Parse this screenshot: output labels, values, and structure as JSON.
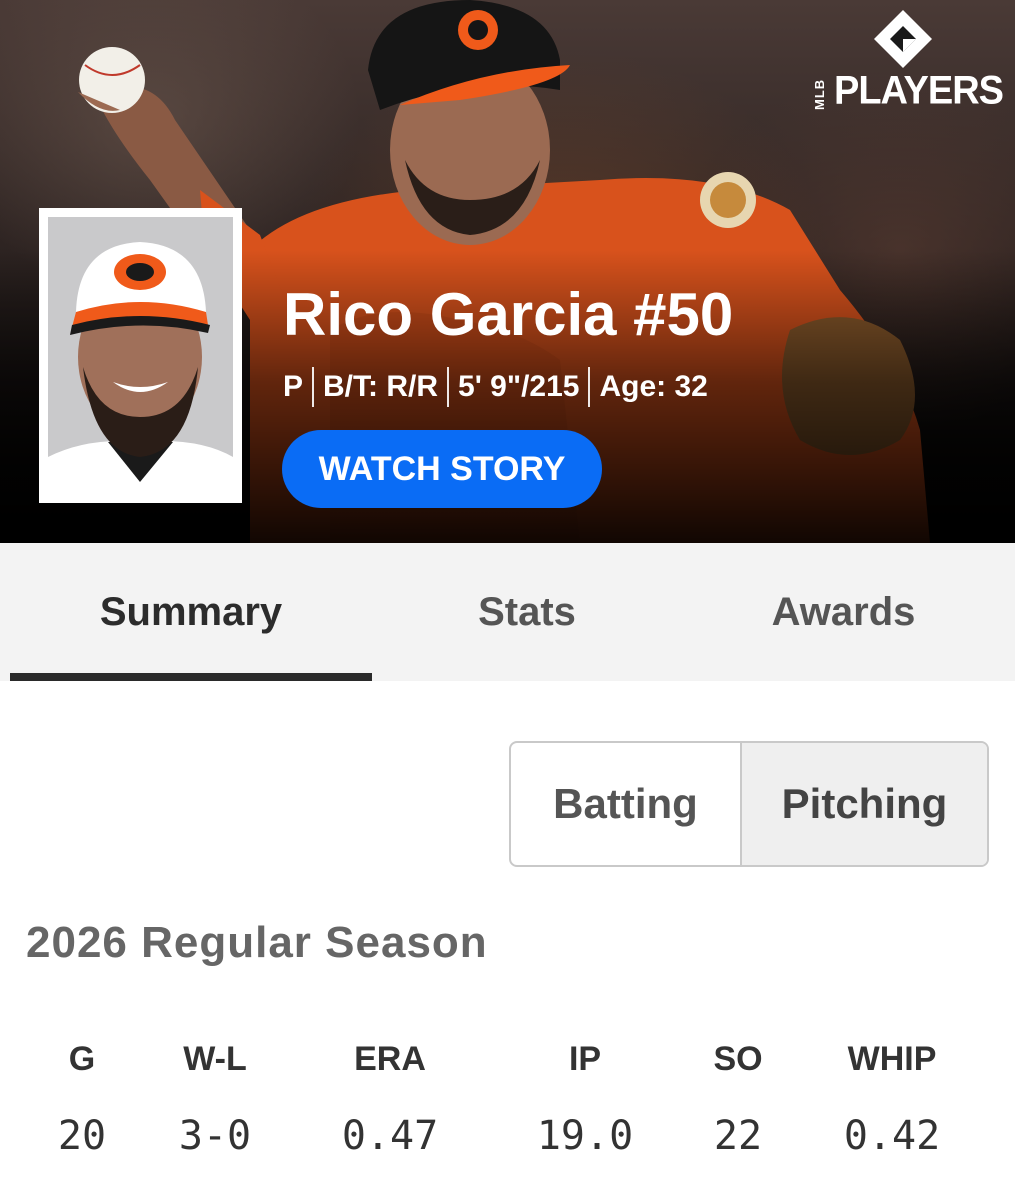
{
  "brand": {
    "side": "MLB",
    "word": "PLAYERS"
  },
  "player": {
    "name": "Rico Garcia #50",
    "position": "P",
    "bats_throws": "B/T: R/R",
    "height_weight": "5' 9\"/215",
    "age": "Age: 32"
  },
  "watch_story_label": "WATCH STORY",
  "tabs": [
    {
      "label": "Summary",
      "active": true
    },
    {
      "label": "Stats",
      "active": false
    },
    {
      "label": "Awards",
      "active": false
    }
  ],
  "toggle": {
    "batting": "Batting",
    "pitching": "Pitching",
    "selected": "Pitching"
  },
  "season": {
    "title": "2026 Regular Season",
    "headers": [
      "G",
      "W-L",
      "ERA",
      "IP",
      "SO",
      "WHIP"
    ],
    "values": [
      "20",
      "3-0",
      "0.47",
      "19.0",
      "22",
      "0.42"
    ]
  },
  "colors": {
    "accent": "#0a6cf5",
    "orioles_orange": "#f05a1a"
  }
}
